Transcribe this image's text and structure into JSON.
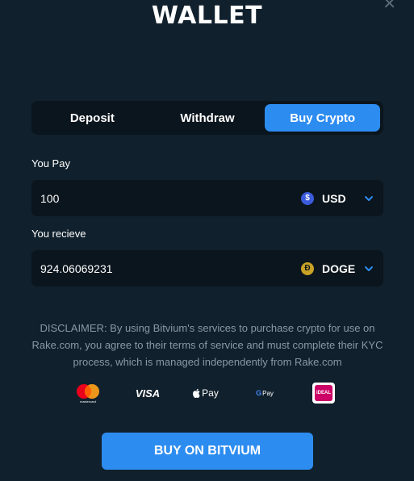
{
  "header": {
    "title": "WALLET"
  },
  "tabs": [
    {
      "label": "Deposit",
      "active": false
    },
    {
      "label": "Withdraw",
      "active": false
    },
    {
      "label": "Buy Crypto",
      "active": true
    }
  ],
  "pay": {
    "label": "You Pay",
    "amount": "100",
    "currency": "USD",
    "currency_icon": "usd-coin-icon",
    "currency_glyph": "$"
  },
  "receive": {
    "label": "You recieve",
    "amount": "924.06069231",
    "currency": "DOGE",
    "currency_icon": "doge-coin-icon",
    "currency_glyph": "Ð"
  },
  "disclaimer": "DISCLAIMER: By using Bitvium's services to purchase crypto for use on Rake.com, you agree to their terms of service and must complete their KYC process, which is managed independently from Rake.com",
  "payment_methods": {
    "mastercard_text": "mastercard",
    "visa": "VISA",
    "apple_pay": "Pay",
    "google_pay": "Pay",
    "ideal": "iDEAL"
  },
  "buy_button": {
    "label": "BUY ON BITVIUM"
  },
  "colors": {
    "accent": "#2d8cf0",
    "background": "#10202c",
    "field": "#0b151d"
  }
}
